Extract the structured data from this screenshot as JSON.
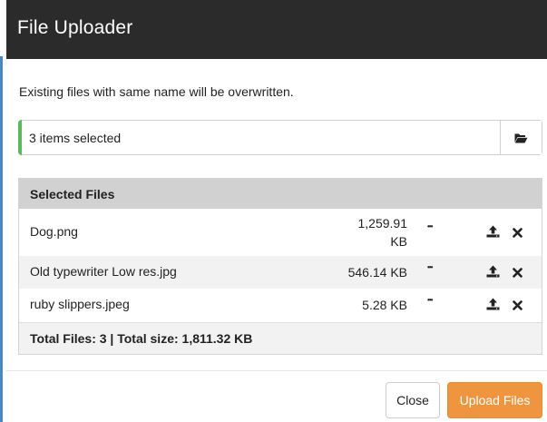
{
  "dialog": {
    "title": "File Uploader",
    "notice": "Existing files with same name will be overwritten."
  },
  "picker": {
    "value": "3 items selected",
    "icon": "folder-open-icon"
  },
  "files": {
    "heading": "Selected Files",
    "rows": [
      {
        "name": "Dog.png",
        "size_line1": "1,259.91",
        "size_line2": "KB",
        "more": "•••"
      },
      {
        "name": "Old typewriter Low res.jpg",
        "size": "546.14 KB",
        "more": "•••"
      },
      {
        "name": "ruby slippers.jpeg",
        "size": "5.28 KB",
        "more": "•••"
      }
    ],
    "total": "Total Files: 3 | Total size: 1,811.32 KB"
  },
  "buttons": {
    "close": "Close",
    "upload": "Upload Files"
  },
  "colors": {
    "header_bg": "#2b2b2b",
    "accent_green": "#5cb85c",
    "upload_orange": "#f0953f",
    "table_header": "#d1d1d1"
  }
}
